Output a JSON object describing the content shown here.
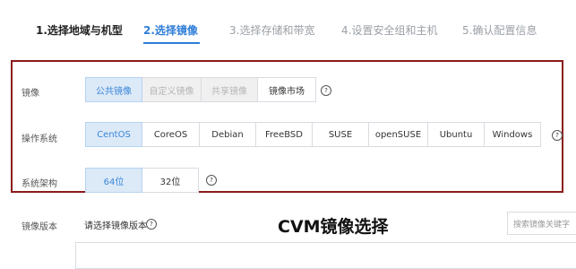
{
  "steps": [
    {
      "label": "1.选择地域与机型"
    },
    {
      "label": "2.选择镜像"
    },
    {
      "label": "3.选择存储和带宽"
    },
    {
      "label": "4.设置安全组和主机"
    },
    {
      "label": "5.确认配置信息"
    }
  ],
  "image": {
    "label": "镜像",
    "options": [
      "公共镜像",
      "自定义镜像",
      "共享镜像",
      "镜像市场"
    ],
    "selected": "公共镜像"
  },
  "os": {
    "label": "操作系统",
    "options": [
      "CentOS",
      "CoreOS",
      "Debian",
      "FreeBSD",
      "SUSE",
      "openSUSE",
      "Ubuntu",
      "Windows"
    ],
    "selected": "CentOS"
  },
  "arch": {
    "label": "系统架构",
    "options": [
      "64位",
      "32位"
    ],
    "selected": "64位"
  },
  "help_glyph": "?",
  "version": {
    "label": "镜像版本",
    "select_text": "请选择镜像版本",
    "search_placeholder": "搜索镜像关键字"
  },
  "caption": "CVM镜像选择",
  "colors": {
    "accent": "#2f7dd8",
    "highlight_border": "#8b1a1a",
    "selected_bg": "#dce9f7"
  }
}
